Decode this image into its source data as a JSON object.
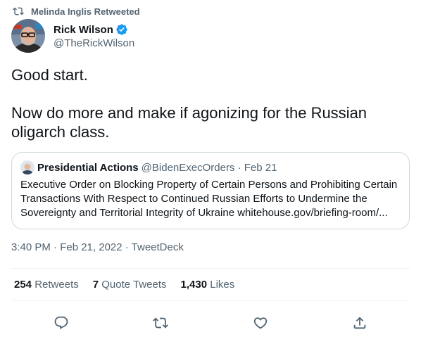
{
  "retweet_context": {
    "text": "Melinda Inglis Retweeted"
  },
  "author": {
    "name": "Rick Wilson",
    "handle": "@TheRickWilson",
    "verified": true
  },
  "tweet": {
    "paragraph_1": "Good start.",
    "paragraph_2": "Now do more and make if agonizing for the Russian oligarch class."
  },
  "quoted_tweet": {
    "name": "Presidential Actions",
    "handle_and_date": "@BidenExecOrders · Feb 21",
    "text": "Executive Order on Blocking Property of Certain Persons and Prohibiting Certain Transactions With Respect to Continued Russian Efforts to Undermine the Sovereignty and Territorial Integrity of Ukraine whitehouse.gov/briefing-room/..."
  },
  "timestamp": "3:40 PM · Feb 21, 2022 · TweetDeck",
  "stats": {
    "retweets_count": "254",
    "retweets_label": "Retweets",
    "quote_count": "7",
    "quote_label": "Quote Tweets",
    "likes_count": "1,430",
    "likes_label": "Likes"
  },
  "actions": [
    "reply-icon",
    "retweet-icon",
    "like-icon",
    "share-icon"
  ],
  "colors": {
    "text": "#0f1419",
    "secondary": "#536471",
    "border": "#cfd9de",
    "verified": "#1d9bf0"
  }
}
